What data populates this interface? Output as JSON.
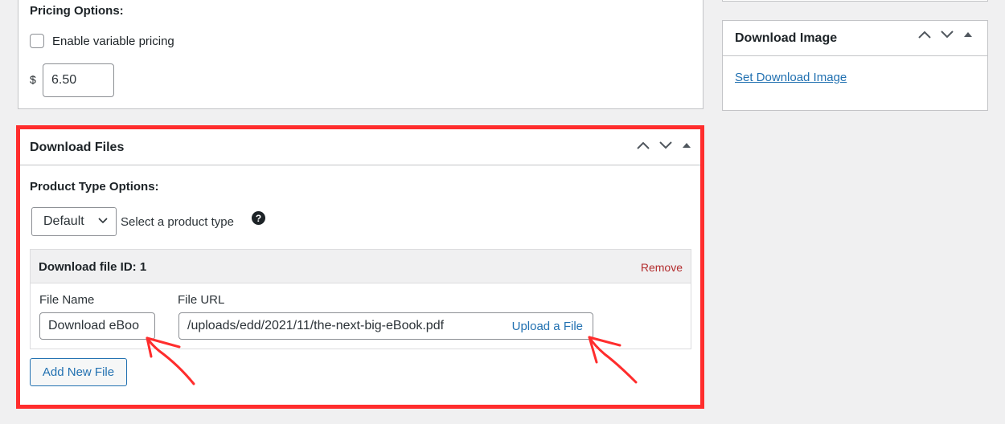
{
  "pricing": {
    "title": "Pricing Options:",
    "variable_label": "Enable variable pricing",
    "variable_checked": false,
    "currency": "$",
    "price_value": "6.50"
  },
  "download_image": {
    "title": "Download Image",
    "set_link": "Set Download Image"
  },
  "download_files": {
    "title": "Download Files",
    "product_type_label": "Product Type Options:",
    "product_type_selected": "Default",
    "product_type_hint": "Select a product type",
    "help_glyph": "?",
    "file": {
      "id_label": "Download file ID: 1",
      "remove": "Remove",
      "name_label": "File Name",
      "name_value": "Download eBoo",
      "url_label": "File URL",
      "url_value": "/uploads/edd/2021/11/the-next-big-eBook.pdf",
      "upload": "Upload a File"
    },
    "add_new": "Add New File"
  },
  "icons": {
    "move_up": "chevron-up-icon",
    "move_down": "chevron-down-icon",
    "toggle": "triangle-up-icon"
  },
  "colors": {
    "highlight": "#ff2d2d",
    "link": "#2271b1",
    "remove": "#b32d2e",
    "background": "#f0f0f1"
  }
}
